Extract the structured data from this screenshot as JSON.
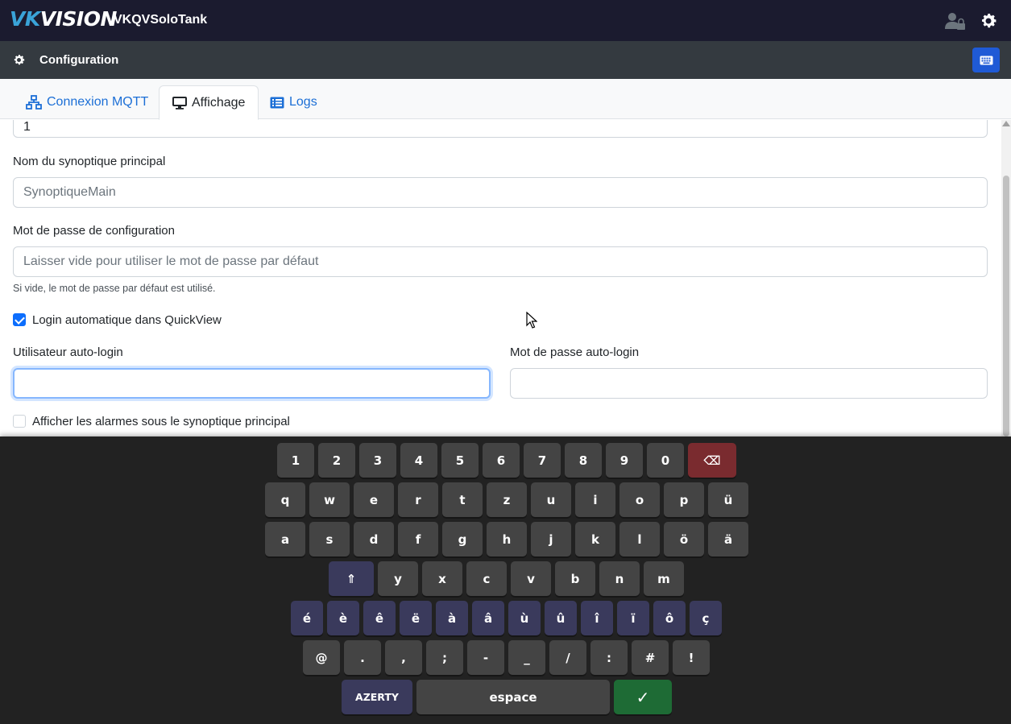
{
  "topbar": {
    "logo_vk": "VK",
    "logo_rest": "VISION",
    "app_title": "VKQVSoloTank",
    "user_icon": "user-lock-icon",
    "settings_icon": "gear-icon"
  },
  "config_header": {
    "title": "Configuration",
    "icon": "gear-icon",
    "keyboard_button_icon": "keyboard-icon"
  },
  "tabs": [
    {
      "label": "Connexion MQTT",
      "icon": "network-icon",
      "active": false
    },
    {
      "label": "Affichage",
      "icon": "monitor-icon",
      "active": true
    },
    {
      "label": "Logs",
      "icon": "list-icon",
      "active": false
    }
  ],
  "form": {
    "top_field_value": "1",
    "synoptic_label": "Nom du synoptique principal",
    "synoptic_value": "SynoptiqueMain",
    "password_label": "Mot de passe de configuration",
    "password_placeholder": "Laisser vide pour utiliser le mot de passe par défaut",
    "password_hint": "Si vide, le mot de passe par défaut est utilisé.",
    "autologin_checkbox_label": "Login automatique dans QuickView",
    "autologin_checked": true,
    "autologin_user_label": "Utilisateur auto-login",
    "autologin_user_value": "",
    "autologin_password_label": "Mot de passe auto-login",
    "autologin_password_value": "",
    "alarms_checkbox_label": "Afficher les alarmes sous le synoptique principal",
    "alarms_checked": false
  },
  "keyboard": {
    "row_numbers": [
      "1",
      "2",
      "3",
      "4",
      "5",
      "6",
      "7",
      "8",
      "9",
      "0"
    ],
    "backspace": "⌫",
    "row_q": [
      "q",
      "w",
      "e",
      "r",
      "t",
      "z",
      "u",
      "i",
      "o",
      "p",
      "ü"
    ],
    "row_a": [
      "a",
      "s",
      "d",
      "f",
      "g",
      "h",
      "j",
      "k",
      "l",
      "ö",
      "ä"
    ],
    "shift": "⇑",
    "row_y": [
      "y",
      "x",
      "c",
      "v",
      "b",
      "n",
      "m"
    ],
    "row_accents": [
      "é",
      "è",
      "ê",
      "ë",
      "à",
      "â",
      "ù",
      "û",
      "î",
      "ï",
      "ô",
      "ç"
    ],
    "row_symbols": [
      "@",
      ".",
      ",",
      ";",
      "-",
      "_",
      "/",
      ":",
      "#",
      "!"
    ],
    "layout_label": "AZERTY",
    "space_label": "espace",
    "ok_label": "✓"
  },
  "colors": {
    "topbar_bg": "#1b1b2f",
    "config_bar_bg": "#343a40",
    "link_blue": "#1c6fd6",
    "keyboard_bg": "#222222",
    "key_bg": "#444444",
    "accent_key_bg": "#3a3a5c",
    "backspace_bg": "#7a2b2f",
    "ok_bg": "#1e6b35"
  }
}
